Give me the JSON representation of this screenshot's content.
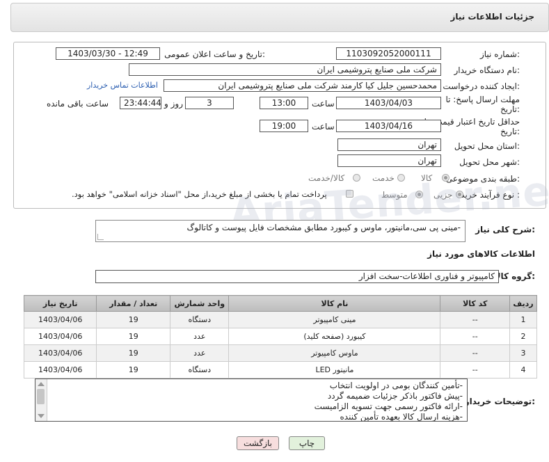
{
  "header": {
    "title": "جزئیات اطلاعات نیاز"
  },
  "watermark": "AriaTender.neT",
  "need_number": {
    "label": "شماره نیاز:",
    "value": "1103092052000111"
  },
  "announce": {
    "label": "تاریخ و ساعت اعلان عمومی:",
    "value": "1403/03/30 - 12:49"
  },
  "buyer_org": {
    "label": "نام دستگاه خریدار:",
    "value": "شرکت ملی صنایع پتروشیمی ایران"
  },
  "requester": {
    "label": "ایجاد کننده درخواست:",
    "value": "محمدحسین جلیل کیا کارمند شرکت ملی صنایع پتروشیمی ایران",
    "contact_link": "اطلاعات تماس خریدار"
  },
  "reply_deadline": {
    "label_line1": "مهلت ارسال پاسخ: تا",
    "label_line2": "تاریخ:",
    "date": "1403/04/03",
    "time_label": "ساعت",
    "time": "13:00",
    "days": "3",
    "days_label": "روز و",
    "remaining": "23:44:44",
    "remaining_label": "ساعت باقی مانده"
  },
  "price_validity": {
    "label_line1": "حداقل تاریخ اعتبار قیمت: تا",
    "label_line2": "تاریخ:",
    "date": "1403/04/16",
    "time_label": "ساعت",
    "time": "19:00"
  },
  "province": {
    "label": "استان محل تحویل:",
    "value": "تهران"
  },
  "city": {
    "label": "شهر محل تحویل:",
    "value": "تهران"
  },
  "category": {
    "label": "طبقه بندی موضوعی:",
    "options": [
      "کالا",
      "خدمت",
      "کالا/خدمت"
    ],
    "selected": "کالا"
  },
  "process": {
    "label": "نوع فرآیند خرید :",
    "options": [
      "جزیی",
      "متوسط"
    ],
    "selected": "جزیی",
    "payment_note": "پرداخت تمام یا بخشی از مبلغ خرید،از محل \"اسناد خزانه اسلامی\" خواهد بود."
  },
  "description": {
    "label": "شرح کلی نیاز:",
    "value": "-مینی پی سی،مانیتور، ماوس و کیبورد مطابق مشخصات فایل پیوست و کاتالوگ"
  },
  "goods_info": {
    "title": "اطلاعات کالاهای مورد نیاز"
  },
  "goods_group": {
    "label": "گروه کالا:",
    "value": "کامپیوتر و فناوری اطلاعات-سخت افزار"
  },
  "table": {
    "headers": [
      "ردیف",
      "کد کالا",
      "نام کالا",
      "واحد شمارش",
      "تعداد / مقدار",
      "تاریخ نیاز"
    ],
    "rows": [
      [
        "1",
        "--",
        "مینی کامپیوتر",
        "دستگاه",
        "19",
        "1403/04/06"
      ],
      [
        "2",
        "--",
        "کیبورد (صفحه کلید)",
        "عدد",
        "19",
        "1403/04/06"
      ],
      [
        "3",
        "--",
        "ماوس کامپیوتر",
        "عدد",
        "19",
        "1403/04/06"
      ],
      [
        "4",
        "--",
        "مانیتور LED",
        "دستگاه",
        "19",
        "1403/04/06"
      ]
    ]
  },
  "buyer_notes": {
    "label": "توضیحات خریدار:",
    "lines": [
      "-تأمین کنندگان بومی در اولویت انتخاب",
      "-پیش فاکتور باذکر جزئیات ضمیمه گردد",
      "-ارائه فاکتور رسمی جهت تسویه الزامیست",
      "-هزینه ارسال کالا بعهده تأمین کننده"
    ]
  },
  "buttons": {
    "print": "چاپ",
    "back": "بازگشت"
  }
}
